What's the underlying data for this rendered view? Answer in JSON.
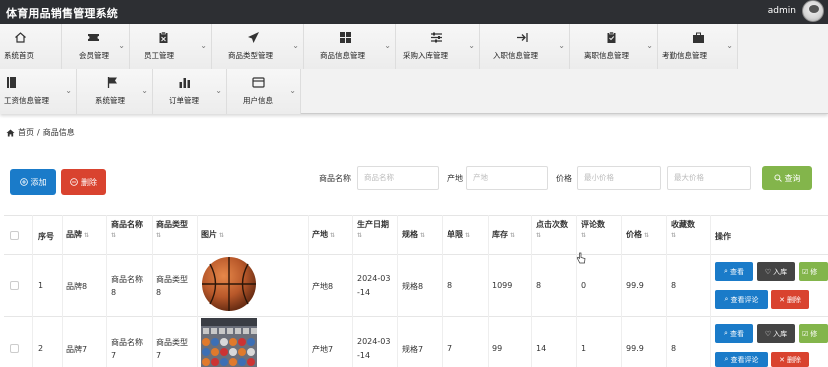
{
  "app": {
    "title": "体育用品销售管理系统",
    "user": "admin"
  },
  "nav": {
    "row1": [
      {
        "label": "系统首页",
        "icon": "home-icon"
      },
      {
        "label": "会员管理",
        "icon": "ticket-icon"
      },
      {
        "label": "员工管理",
        "icon": "clipboard-icon"
      },
      {
        "label": "商品类型管理",
        "icon": "send-icon"
      },
      {
        "label": "商品信息管理",
        "icon": "grid-icon"
      },
      {
        "label": "采购入库管理",
        "icon": "sliders-icon"
      },
      {
        "label": "入职信息管理",
        "icon": "arrow-right-icon"
      },
      {
        "label": "离职信息管理",
        "icon": "clipboard-check-icon"
      },
      {
        "label": "考勤信息管理",
        "icon": "briefcase-icon"
      }
    ],
    "row2": [
      {
        "label": "工资信息管理",
        "icon": "book-icon"
      },
      {
        "label": "系统管理",
        "icon": "flag-icon"
      },
      {
        "label": "订单管理",
        "icon": "bar-chart-icon"
      },
      {
        "label": "用户信息",
        "icon": "card-icon"
      }
    ]
  },
  "breadcrumb": {
    "home": "首页",
    "sep": "/",
    "current": "商品信息"
  },
  "toolbar": {
    "add_label": "添加",
    "delete_label": "删除"
  },
  "search": {
    "name_label": "商品名称",
    "name_placeholder": "商品名称",
    "origin_label": "产地",
    "origin_placeholder": "产地",
    "price_label": "价格",
    "min_placeholder": "最小价格",
    "max_placeholder": "最大价格",
    "query_label": "查询"
  },
  "table": {
    "headers": {
      "index": "序号",
      "brand": "品牌",
      "name": "商品名称",
      "type": "商品类型",
      "image": "图片",
      "origin": "产地",
      "date": "生产日期",
      "spec": "规格",
      "limit": "单限",
      "stock": "库存",
      "clicks": "点击次数",
      "comments": "评论数",
      "price": "价格",
      "favorites": "收藏数",
      "actions": "操作"
    },
    "rows": [
      {
        "index": "1",
        "brand": "品牌8",
        "name1": "商品名称",
        "name2": "8",
        "type1": "商品类型",
        "type2": "8",
        "origin": "产地8",
        "date1": "2024-03",
        "date2": "-14",
        "spec": "规格8",
        "limit": "8",
        "stock": "1099",
        "clicks": "8",
        "comments": "0",
        "price": "99.9",
        "favorites": "8",
        "image": "basketball"
      },
      {
        "index": "2",
        "brand": "品牌7",
        "name1": "商品名称",
        "name2": "7",
        "type1": "商品类型",
        "type2": "7",
        "origin": "产地7",
        "date1": "2024-03",
        "date2": "-14",
        "spec": "规格7",
        "limit": "7",
        "stock": "99",
        "clicks": "14",
        "comments": "1",
        "price": "99.9",
        "favorites": "8",
        "image": "store-shelves"
      }
    ],
    "row_actions": {
      "view": "查看",
      "stock_in": "入库",
      "edit": "修",
      "view_comments": "查看评论",
      "delete": "删除"
    }
  },
  "colors": {
    "primary": "#1a7bc9",
    "danger": "#d9432f",
    "success": "#83b54b",
    "dark": "#444444",
    "topbar": "#2d2f33"
  }
}
